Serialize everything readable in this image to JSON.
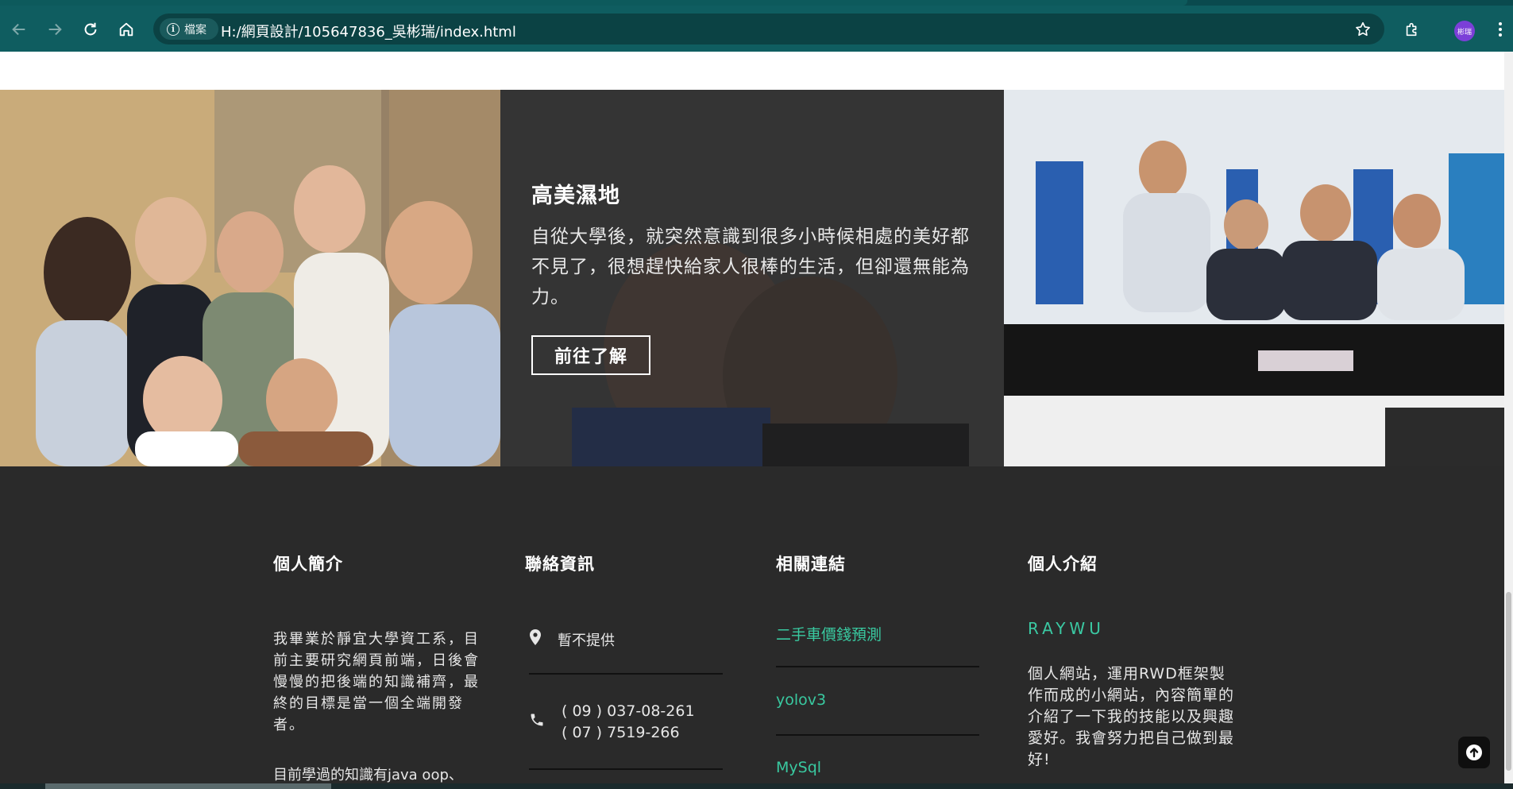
{
  "browser": {
    "back_icon": "arrow-left-icon",
    "forward_icon": "arrow-right-icon",
    "reload_icon": "reload-icon",
    "home_icon": "home-icon",
    "site_chip_label": "檔案",
    "url": "H:/網頁設計/105647836_吳彬瑞/index.html",
    "profile_initials": "彬瑞",
    "accent": "#0f5d60"
  },
  "hero": {
    "caption_title": "高美濕地",
    "caption_text": "自從大學後，就突然意識到很多小時候相處的美好都不見了，很想趕快給家人很棒的生活，但卻還無能為力。",
    "caption_button": "前往了解"
  },
  "footer": {
    "intro": {
      "title": "個人簡介",
      "text": "我畢業於靜宜大學資工系，目前主要研究網頁前端，日後會慢慢的把後端的知識補齊，最終的目標是當一個全端開發者。",
      "text2": "目前學過的知識有java oop、"
    },
    "contact": {
      "title": "聯絡資訊",
      "address": "暫不提供",
      "phone1": "( 09 ) 037-08-261",
      "phone2": "( 07 ) 7519-266"
    },
    "links": {
      "title": "相關連結",
      "items": [
        "二手車價錢預測",
        "yolov3",
        "MySql"
      ]
    },
    "about": {
      "title": "個人介紹",
      "brand": "RAYWU",
      "text": "個人網站，運用RWD框架製作而成的小網站，內容簡單的介紹了一下我的技能以及興趣愛好。我會努力把自己做到最好!"
    },
    "accent_color": "#3bc9a3"
  }
}
